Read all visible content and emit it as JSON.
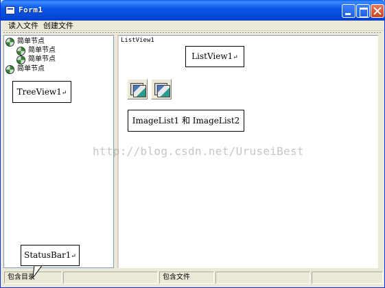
{
  "window": {
    "title": "Form1"
  },
  "menu": {
    "items": [
      "读入文件",
      "创建文件"
    ]
  },
  "tree": {
    "nodes": [
      {
        "label": "简单节点",
        "level": 0
      },
      {
        "label": "简单节点",
        "level": 1
      },
      {
        "label": "简单节点",
        "level": 1
      },
      {
        "label": "简单节点",
        "level": 0
      }
    ]
  },
  "listview": {
    "caption": "ListView1"
  },
  "callouts": {
    "listview": "ListView1",
    "treeview": "TreeView1",
    "imagelist": "ImageList1 和 ImageList2",
    "statusbar": "StatusBar1"
  },
  "callout_mark": "↵",
  "watermark": "http://blog.csdn.net/UruseiBest",
  "status": {
    "panels": [
      "包含目录",
      "",
      "包含文件",
      "",
      ""
    ]
  },
  "icons": {
    "window": "form-window-icon",
    "node": "tree-node-disc-icon",
    "image": "image-list-icon"
  }
}
